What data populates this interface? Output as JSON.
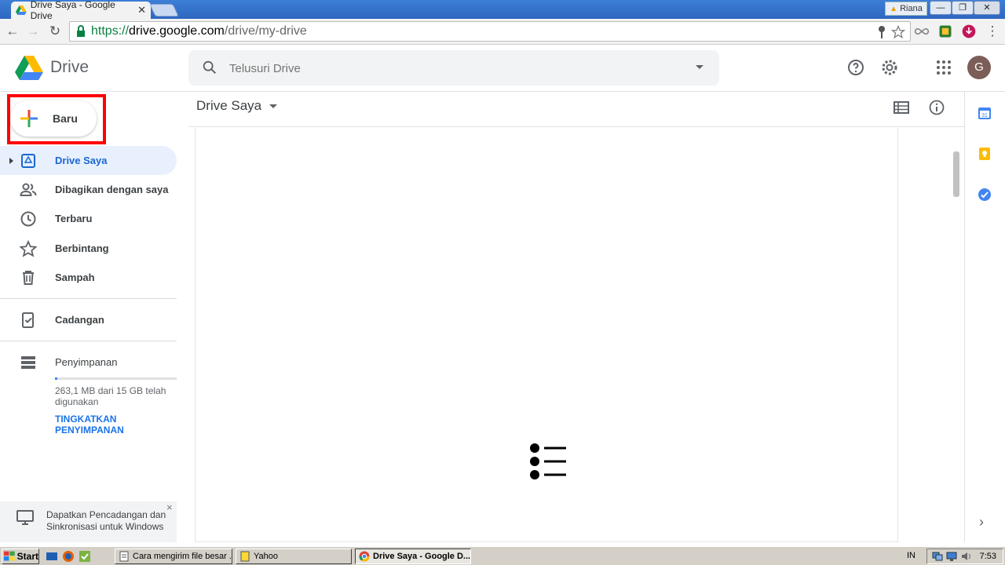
{
  "browser": {
    "tab_title": "Drive Saya - Google Drive",
    "tab_close": "✕",
    "user_label": "Riana",
    "url_scheme": "https://",
    "url_host": "drive.google.com",
    "url_path": "/drive/my-drive"
  },
  "header": {
    "logo_text": "Drive",
    "search_placeholder": "Telusuri Drive",
    "avatar_initial": "G"
  },
  "sidebar": {
    "new_label": "Baru",
    "items": [
      {
        "label": "Drive Saya"
      },
      {
        "label": "Dibagikan dengan saya"
      },
      {
        "label": "Terbaru"
      },
      {
        "label": "Berbintang"
      },
      {
        "label": "Sampah"
      },
      {
        "label": "Cadangan"
      },
      {
        "label": "Penyimpanan"
      }
    ],
    "storage_used": 0.017,
    "storage_text": "263,1 MB dari 15 GB telah digunakan",
    "upgrade_label": "TINGKATKAN PENYIMPANAN",
    "promo_text": "Dapatkan Pencadangan dan Sinkronisasi untuk Windows",
    "promo_close": "×"
  },
  "main": {
    "breadcrumb": "Drive Saya"
  },
  "side_panel": {
    "calendar_day": "31",
    "expand": "›"
  },
  "taskbar": {
    "start_label": "Start",
    "tasks": [
      {
        "label": "Cara mengirim file besar ..."
      },
      {
        "label": "Yahoo"
      },
      {
        "label": "Drive Saya - Google D..."
      }
    ],
    "lang": "IN",
    "clock": "7:53"
  },
  "colors": {
    "accent": "#1a73e8",
    "active_nav_bg": "#e8f0fe",
    "highlight": "#ff0000"
  }
}
